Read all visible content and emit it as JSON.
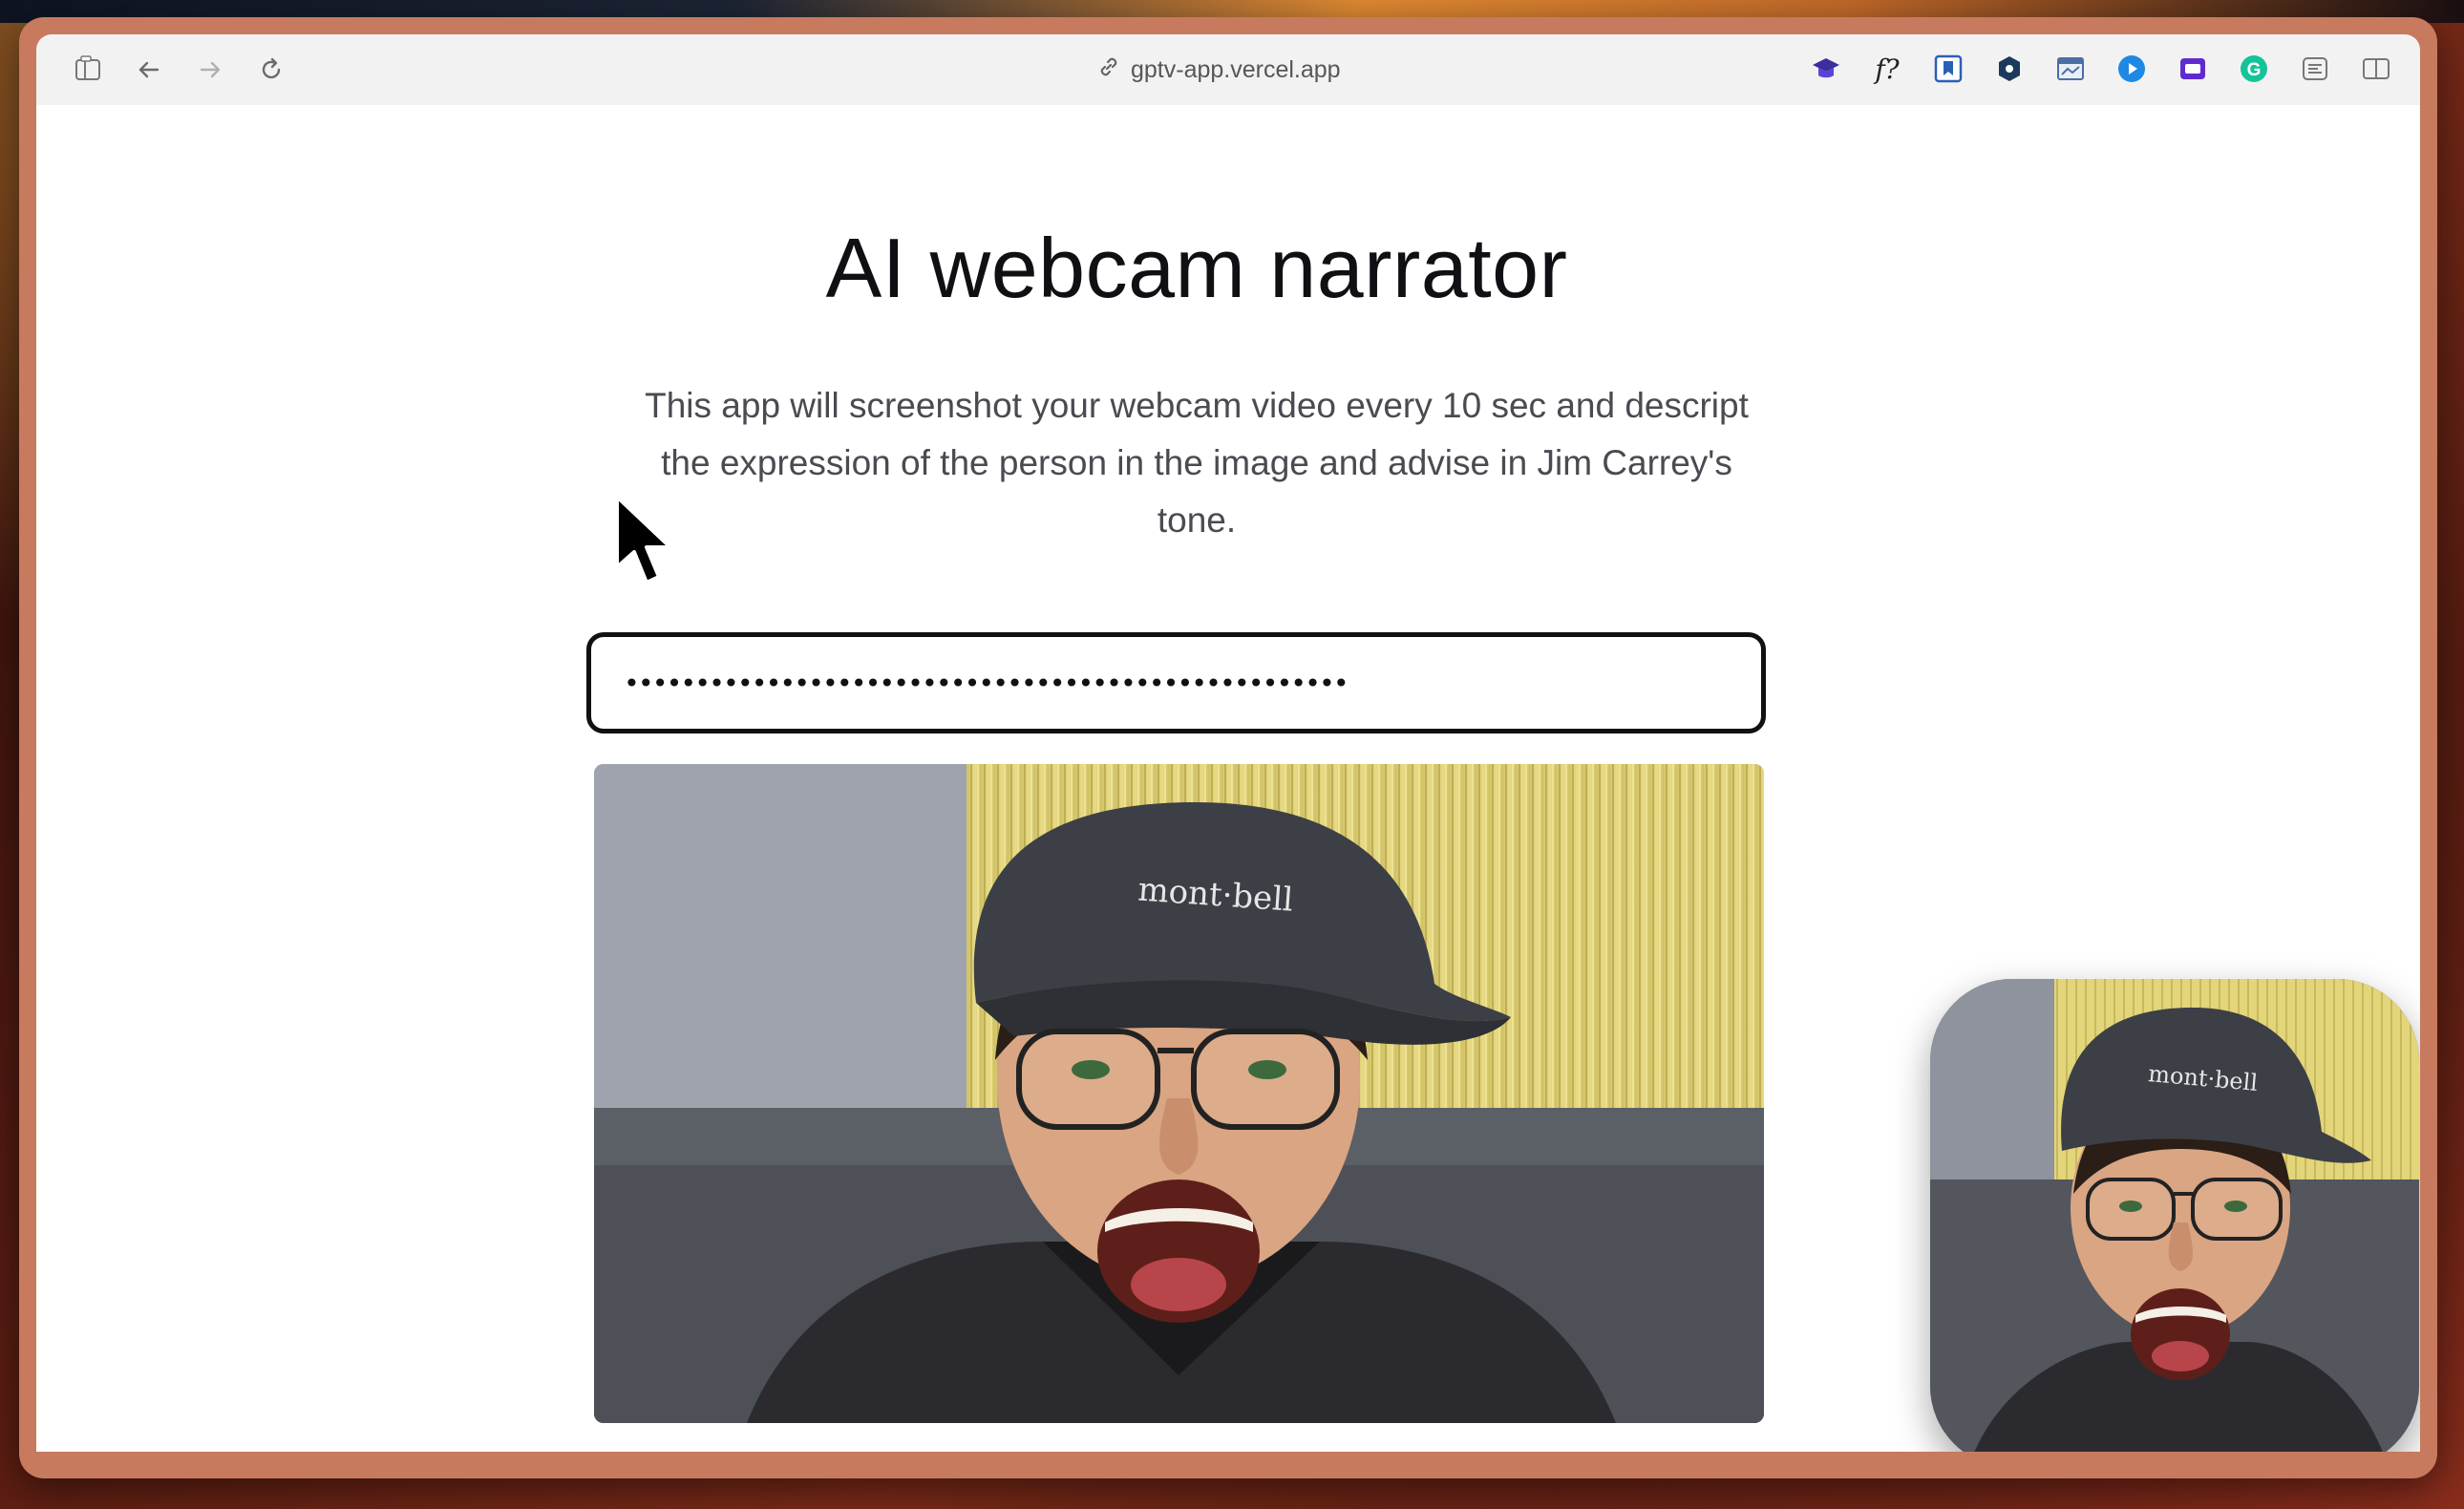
{
  "browser": {
    "url": "gptv-app.vercel.app",
    "icons": {
      "sidebar": "sidebar-icon",
      "back": "back-arrow-icon",
      "forward": "forward-arrow-icon",
      "reload": "reload-icon",
      "link": "link-icon",
      "split_view": "split-view-icon"
    },
    "extensions": [
      {
        "name": "extension-graduation-cap-icon"
      },
      {
        "name": "extension-function-icon",
        "label": "f?"
      },
      {
        "name": "extension-bookmark-icon"
      },
      {
        "name": "extension-hexagon-icon"
      },
      {
        "name": "extension-window-icon"
      },
      {
        "name": "extension-play-icon"
      },
      {
        "name": "extension-video-icon"
      },
      {
        "name": "extension-grammarly-icon",
        "label": "G"
      },
      {
        "name": "extension-menu-icon"
      }
    ]
  },
  "page": {
    "title": "AI webcam narrator",
    "description": "This app will screenshot your webcam video every 10 sec and descript the expression of the person in the image and advise in Jim Carrey's tone.",
    "api_key_input": {
      "value": "•••••••••••••••••••••••••••••••••••••••••••••••••••",
      "type": "password"
    },
    "webcam": {
      "cap_text": "mont·bell"
    },
    "pip": {
      "cap_text": "mont·bell"
    }
  },
  "colors": {
    "title": "#101014",
    "description": "#4a4a52",
    "input_border": "#111111",
    "window_frame": "#c77a5e"
  }
}
